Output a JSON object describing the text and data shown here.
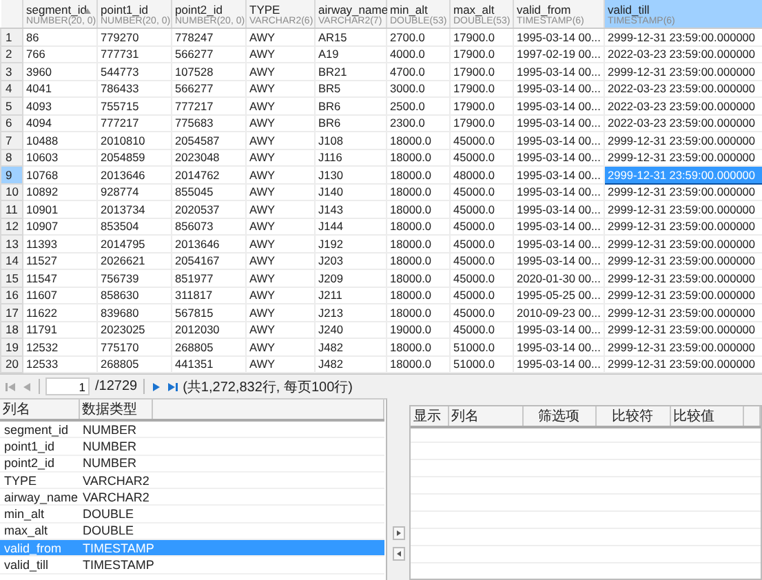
{
  "grid": {
    "columns": [
      {
        "name": "segment_id",
        "type": "NUMBER(20, 0)",
        "selected": false,
        "sorted": true
      },
      {
        "name": "point1_id",
        "type": "NUMBER(20, 0)",
        "selected": false,
        "sorted": false
      },
      {
        "name": "point2_id",
        "type": "NUMBER(20, 0)",
        "selected": false,
        "sorted": false
      },
      {
        "name": "TYPE",
        "type": "VARCHAR2(6)",
        "selected": false,
        "sorted": false
      },
      {
        "name": "airway_name",
        "type": "VARCHAR2(7)",
        "selected": false,
        "sorted": false
      },
      {
        "name": "min_alt",
        "type": "DOUBLE(53)",
        "selected": false,
        "sorted": false
      },
      {
        "name": "max_alt",
        "type": "DOUBLE(53)",
        "selected": false,
        "sorted": false
      },
      {
        "name": "valid_from",
        "type": "TIMESTAMP(6)",
        "selected": false,
        "sorted": false
      },
      {
        "name": "valid_till",
        "type": "TIMESTAMP(6)",
        "selected": true,
        "sorted": false
      }
    ],
    "rows": [
      {
        "number": "1",
        "selected": false,
        "cells": [
          "86",
          "779270",
          "778247",
          "AWY",
          "AR15",
          "2700.0",
          "17900.0",
          "1995-03-14 00...",
          "2999-12-31 23:59:00.000000"
        ]
      },
      {
        "number": "2",
        "selected": false,
        "cells": [
          "766",
          "777731",
          "566277",
          "AWY",
          "A19",
          "4000.0",
          "17900.0",
          "1997-02-19 00...",
          "2022-03-23 23:59:00.000000"
        ]
      },
      {
        "number": "3",
        "selected": false,
        "cells": [
          "3960",
          "544773",
          "107528",
          "AWY",
          "BR21",
          "4700.0",
          "17900.0",
          "1995-03-14 00...",
          "2999-12-31 23:59:00.000000"
        ]
      },
      {
        "number": "4",
        "selected": false,
        "cells": [
          "4041",
          "786433",
          "566277",
          "AWY",
          "BR5",
          "3000.0",
          "17900.0",
          "1995-03-14 00...",
          "2022-03-23 23:59:00.000000"
        ]
      },
      {
        "number": "5",
        "selected": false,
        "cells": [
          "4093",
          "755715",
          "777217",
          "AWY",
          "BR6",
          "2500.0",
          "17900.0",
          "1995-03-14 00...",
          "2022-03-23 23:59:00.000000"
        ]
      },
      {
        "number": "6",
        "selected": false,
        "cells": [
          "4094",
          "777217",
          "775683",
          "AWY",
          "BR6",
          "2300.0",
          "17900.0",
          "1995-03-14 00...",
          "2022-03-23 23:59:00.000000"
        ]
      },
      {
        "number": "7",
        "selected": false,
        "cells": [
          "10488",
          "2010810",
          "2054587",
          "AWY",
          "J108",
          "18000.0",
          "45000.0",
          "1995-03-14 00...",
          "2999-12-31 23:59:00.000000"
        ]
      },
      {
        "number": "8",
        "selected": false,
        "cells": [
          "10603",
          "2054859",
          "2023048",
          "AWY",
          "J116",
          "18000.0",
          "45000.0",
          "1995-03-14 00...",
          "2999-12-31 23:59:00.000000"
        ]
      },
      {
        "number": "9",
        "selected": true,
        "cells": [
          "10768",
          "2013646",
          "2014762",
          "AWY",
          "J130",
          "18000.0",
          "48000.0",
          "1995-03-14 00...",
          "2999-12-31 23:59:00.000000"
        ]
      },
      {
        "number": "10",
        "selected": false,
        "cells": [
          "10892",
          "928774",
          "855045",
          "AWY",
          "J140",
          "18000.0",
          "45000.0",
          "1995-03-14 00...",
          "2999-12-31 23:59:00.000000"
        ]
      },
      {
        "number": "11",
        "selected": false,
        "cells": [
          "10901",
          "2013734",
          "2020537",
          "AWY",
          "J143",
          "18000.0",
          "45000.0",
          "1995-03-14 00...",
          "2999-12-31 23:59:00.000000"
        ]
      },
      {
        "number": "12",
        "selected": false,
        "cells": [
          "10907",
          "853504",
          "856073",
          "AWY",
          "J144",
          "18000.0",
          "45000.0",
          "1995-03-14 00...",
          "2999-12-31 23:59:00.000000"
        ]
      },
      {
        "number": "13",
        "selected": false,
        "cells": [
          "11393",
          "2014795",
          "2013646",
          "AWY",
          "J192",
          "18000.0",
          "45000.0",
          "1995-03-14 00...",
          "2999-12-31 23:59:00.000000"
        ]
      },
      {
        "number": "14",
        "selected": false,
        "cells": [
          "11527",
          "2026621",
          "2054167",
          "AWY",
          "J203",
          "18000.0",
          "45000.0",
          "1995-03-14 00...",
          "2999-12-31 23:59:00.000000"
        ]
      },
      {
        "number": "15",
        "selected": false,
        "cells": [
          "11547",
          "756739",
          "851977",
          "AWY",
          "J209",
          "18000.0",
          "45000.0",
          "2020-01-30 00...",
          "2999-12-31 23:59:00.000000"
        ]
      },
      {
        "number": "16",
        "selected": false,
        "cells": [
          "11607",
          "858630",
          "311817",
          "AWY",
          "J211",
          "18000.0",
          "45000.0",
          "1995-05-25 00...",
          "2999-12-31 23:59:00.000000"
        ]
      },
      {
        "number": "17",
        "selected": false,
        "cells": [
          "11622",
          "839680",
          "567815",
          "AWY",
          "J213",
          "18000.0",
          "45000.0",
          "2010-09-23 00...",
          "2999-12-31 23:59:00.000000"
        ]
      },
      {
        "number": "18",
        "selected": false,
        "cells": [
          "11791",
          "2023025",
          "2012030",
          "AWY",
          "J240",
          "19000.0",
          "45000.0",
          "1995-03-14 00...",
          "2999-12-31 23:59:00.000000"
        ]
      },
      {
        "number": "19",
        "selected": false,
        "cells": [
          "12532",
          "775170",
          "268805",
          "AWY",
          "J482",
          "18000.0",
          "51000.0",
          "1995-03-14 00...",
          "2999-12-31 23:59:00.000000"
        ]
      },
      {
        "number": "20",
        "selected": false,
        "cells": [
          "12533",
          "268805",
          "441351",
          "AWY",
          "J482",
          "18000.0",
          "51000.0",
          "1995-03-14 00...",
          "2999-12-31 23:59:00.000000"
        ]
      }
    ]
  },
  "pager": {
    "page": "1",
    "total_pages": "/12729",
    "summary": "(共1,272,832行, 每页100行)"
  },
  "column_list": {
    "headers": [
      "列名",
      "数据类型"
    ],
    "rows": [
      {
        "name": "segment_id",
        "type": "NUMBER",
        "selected": false
      },
      {
        "name": "point1_id",
        "type": "NUMBER",
        "selected": false
      },
      {
        "name": "point2_id",
        "type": "NUMBER",
        "selected": false
      },
      {
        "name": "TYPE",
        "type": "VARCHAR2",
        "selected": false
      },
      {
        "name": "airway_name",
        "type": "VARCHAR2",
        "selected": false
      },
      {
        "name": "min_alt",
        "type": "DOUBLE",
        "selected": false
      },
      {
        "name": "max_alt",
        "type": "DOUBLE",
        "selected": false
      },
      {
        "name": "valid_from",
        "type": "TIMESTAMP",
        "selected": true
      },
      {
        "name": "valid_till",
        "type": "TIMESTAMP",
        "selected": false
      }
    ]
  },
  "filter": {
    "headers": [
      "显示",
      "列名",
      "筛选项",
      "比较符",
      "比较值"
    ]
  }
}
